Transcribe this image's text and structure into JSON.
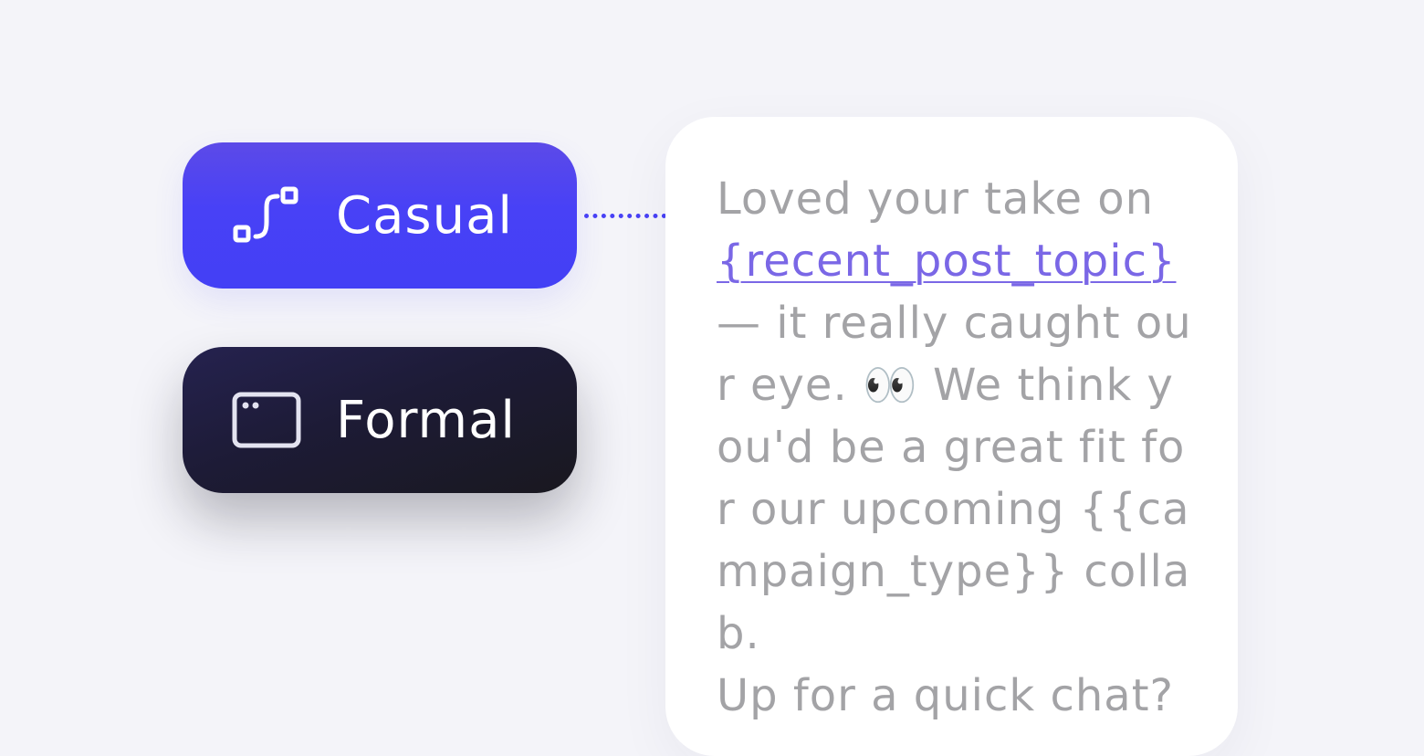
{
  "tones": [
    {
      "label": "Casual",
      "icon": "curved-path-icon",
      "selected": true,
      "color": "#4841f6"
    },
    {
      "label": "Formal",
      "icon": "window-icon",
      "selected": false,
      "color": "#1d1b36"
    }
  ],
  "message": {
    "intro": "Loved your take on",
    "topic_variable": "{recent_post_topic}",
    "after_topic": " — it really caught our eye. ",
    "emoji": "👀",
    "after_emoji": " We think you'd be a great fit for our upcoming {{campaign_type}} collab.",
    "closing": " Up for a quick chat?"
  },
  "colors": {
    "background": "#f4f4f9",
    "accent": "#4841f6",
    "dark": "#1d1b36",
    "text_muted": "#a3a3a6",
    "link": "#7a67e6"
  }
}
